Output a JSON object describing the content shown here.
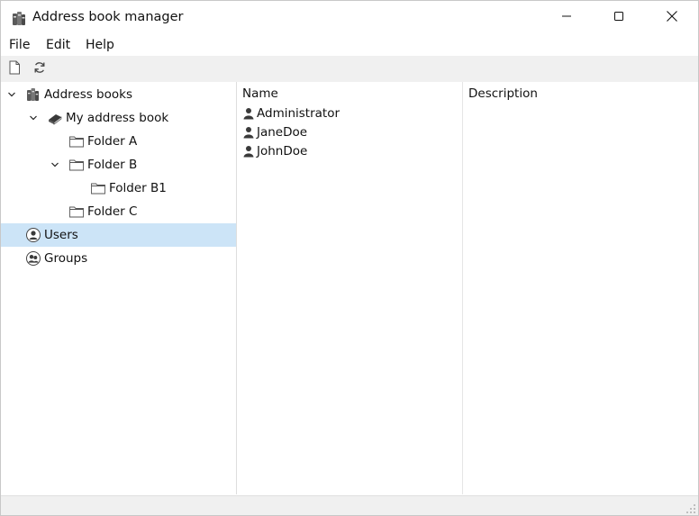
{
  "window": {
    "title": "Address book manager",
    "icon": "address-books-icon"
  },
  "window_controls": {
    "minimize_icon": "minimize-icon",
    "maximize_icon": "maximize-icon",
    "close_icon": "close-icon"
  },
  "menu": [
    "File",
    "Edit",
    "Help"
  ],
  "toolbar": {
    "new_icon": "new-document-icon",
    "refresh_icon": "refresh-icon"
  },
  "tree": {
    "selected": "Users",
    "items": [
      {
        "label": "Address books",
        "icon": "address-books-icon",
        "expanded": true
      },
      {
        "label": "My address book",
        "icon": "address-book-icon",
        "expanded": true
      },
      {
        "label": "Folder A",
        "icon": "folder-icon"
      },
      {
        "label": "Folder B",
        "icon": "folder-icon",
        "expanded": true
      },
      {
        "label": "Folder B1",
        "icon": "folder-icon"
      },
      {
        "label": "Folder C",
        "icon": "folder-icon"
      },
      {
        "label": "Users",
        "icon": "user-circle-icon"
      },
      {
        "label": "Groups",
        "icon": "group-circle-icon"
      }
    ]
  },
  "list": {
    "columns": [
      "Name",
      "Description"
    ],
    "rows": [
      {
        "name": "Administrator",
        "description": "",
        "icon": "user-icon"
      },
      {
        "name": "JaneDoe",
        "description": "",
        "icon": "user-icon"
      },
      {
        "name": "JohnDoe",
        "description": "",
        "icon": "user-icon"
      }
    ]
  },
  "colors": {
    "selection": "#cce4f7",
    "toolbar_bg": "#f0f0f0",
    "border": "#c8c8c8",
    "icon": "#3a3a3a"
  }
}
